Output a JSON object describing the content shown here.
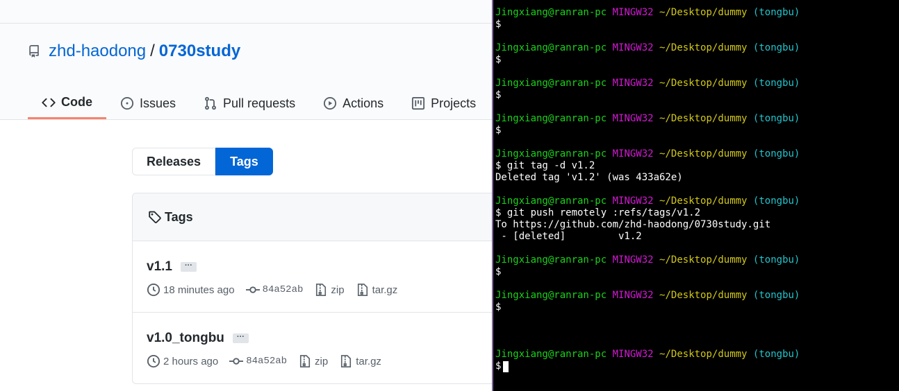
{
  "repo": {
    "owner": "zhd-haodong",
    "separator": "/",
    "name": "0730study"
  },
  "tabs": [
    {
      "label": "Code",
      "icon": "code-icon"
    },
    {
      "label": "Issues",
      "icon": "issue-icon"
    },
    {
      "label": "Pull requests",
      "icon": "pull-request-icon"
    },
    {
      "label": "Actions",
      "icon": "play-icon"
    },
    {
      "label": "Projects",
      "icon": "project-icon"
    }
  ],
  "toggle": {
    "releases": "Releases",
    "tags": "Tags"
  },
  "tags_box": {
    "title": "Tags",
    "rows": [
      {
        "name": "v1.1",
        "more": "···",
        "time": "18 minutes ago",
        "commit": "84a52ab",
        "zip": "zip",
        "tar": "tar.gz"
      },
      {
        "name": "v1.0_tongbu",
        "more": "···",
        "time": "2 hours ago",
        "commit": "84a52ab",
        "zip": "zip",
        "tar": "tar.gz"
      }
    ]
  },
  "terminal": {
    "prompt": {
      "user": "Jingxiang@ranran-pc",
      "system": "MINGW32",
      "path": "~/Desktop/dummy",
      "branch": "(tongbu)"
    },
    "lines": [
      "$",
      "$",
      "$",
      "$",
      "$ git tag -d v1.2",
      "Deleted tag 'v1.2' (was 433a62e)",
      "$ git push remotely :refs/tags/v1.2",
      "To https://github.com/zhd-haodong/0730study.git",
      " - [deleted]         v1.2",
      "$",
      "$",
      "$"
    ],
    "colors": {
      "green": "#19d219",
      "magenta": "#d21ad2",
      "yellow": "#d2c819",
      "cyan": "#22c4cc"
    }
  }
}
